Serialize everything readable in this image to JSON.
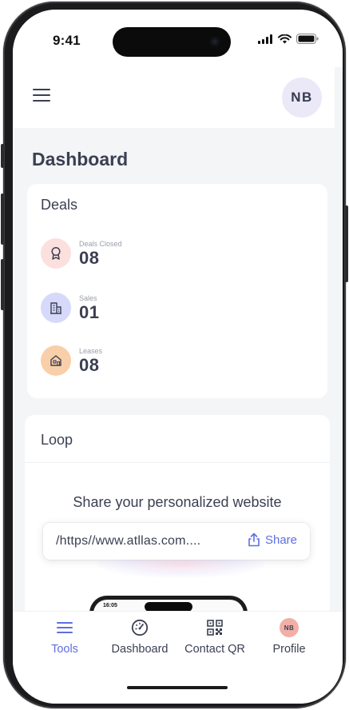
{
  "status_bar": {
    "time": "9:41"
  },
  "header": {
    "avatar_initials": "NB"
  },
  "page_title": "Dashboard",
  "deals_card": {
    "title": "Deals",
    "stats": [
      {
        "label": "Deals Closed",
        "value": "08",
        "icon": "award-icon",
        "color": "#fbe0de"
      },
      {
        "label": "Sales",
        "value": "01",
        "icon": "building-icon",
        "color": "#d6d9fa"
      },
      {
        "label": "Leases",
        "value": "08",
        "icon": "house-icon",
        "color": "#f8cfa9"
      }
    ]
  },
  "loop_card": {
    "title": "Loop",
    "share_heading": "Share your personalized website",
    "url": "/https//www.atllas.com....",
    "share_label": "Share",
    "preview_time": "16:05"
  },
  "tab_bar": {
    "tabs": [
      {
        "label": "Tools",
        "icon": "list-icon",
        "active": true
      },
      {
        "label": "Dashboard",
        "icon": "speedometer-icon",
        "active": false
      },
      {
        "label": "Contact QR",
        "icon": "qr-code-icon",
        "active": false
      },
      {
        "label": "Profile",
        "icon": "avatar",
        "active": false,
        "initials": "NB"
      }
    ],
    "accent_color": "#5d6fe0"
  }
}
